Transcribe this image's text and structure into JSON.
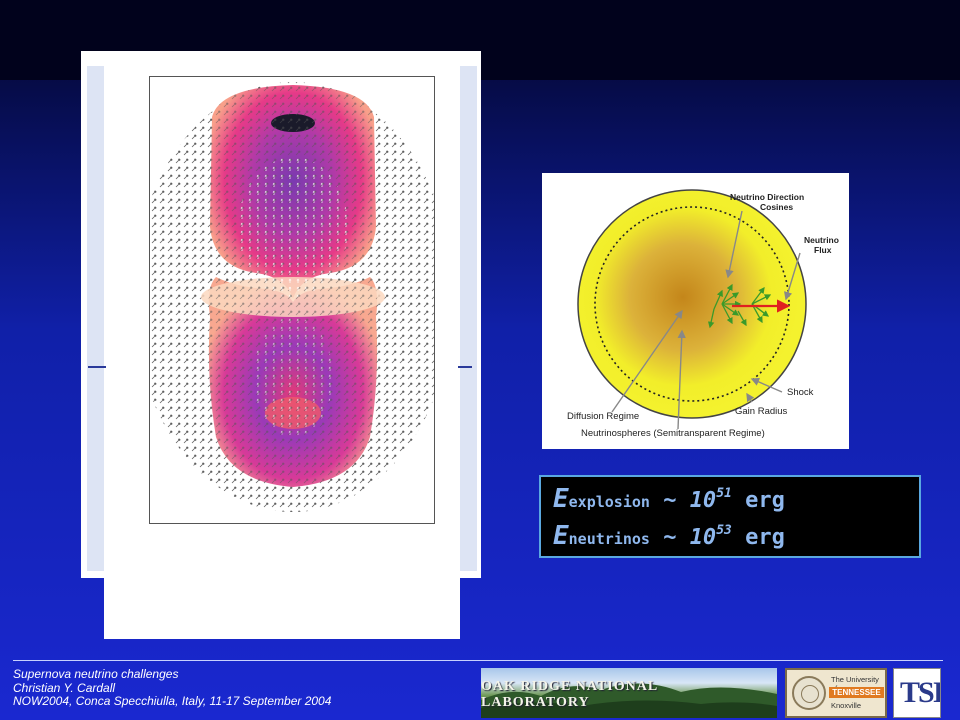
{
  "slide": {
    "diagram": {
      "labels": {
        "direction_cosines": [
          "Neutrino Direction",
          "Cosines"
        ],
        "flux": [
          "Neutrino",
          "Flux"
        ],
        "shock": "Shock",
        "gain_radius": "Gain Radius",
        "diffusion": "Diffusion Regime",
        "neutrinospheres": "Neutrinospheres (Semitransparent Regime)"
      },
      "colors": {
        "star": "#f2ee2a",
        "core": "#c98a1a",
        "arrows": "#3a9a2a",
        "flux_arrow": "#e02020"
      }
    },
    "energy_box": {
      "rows": [
        {
          "E": "E",
          "sub": "explosion",
          "tilde": "~",
          "base": "10",
          "exp": "51",
          "unit": "erg"
        },
        {
          "E": "E",
          "sub": "neutrinos",
          "tilde": "~",
          "base": "10",
          "exp": "53",
          "unit": "erg"
        }
      ],
      "text_color": "#8fb8ee",
      "border_color": "#5aa8e0"
    },
    "footer": {
      "lines": [
        "Supernova neutrino challenges",
        "Christian Y. Cardall",
        "NOW2004, Conca Specchiulla, Italy, 11-17 September 2004"
      ]
    },
    "logos": {
      "ornl": "OAK RIDGE NATIONAL LABORATORY",
      "ut": [
        "The University of",
        "TENNESSEE",
        "Knoxville"
      ],
      "tsi": "TSI"
    }
  }
}
